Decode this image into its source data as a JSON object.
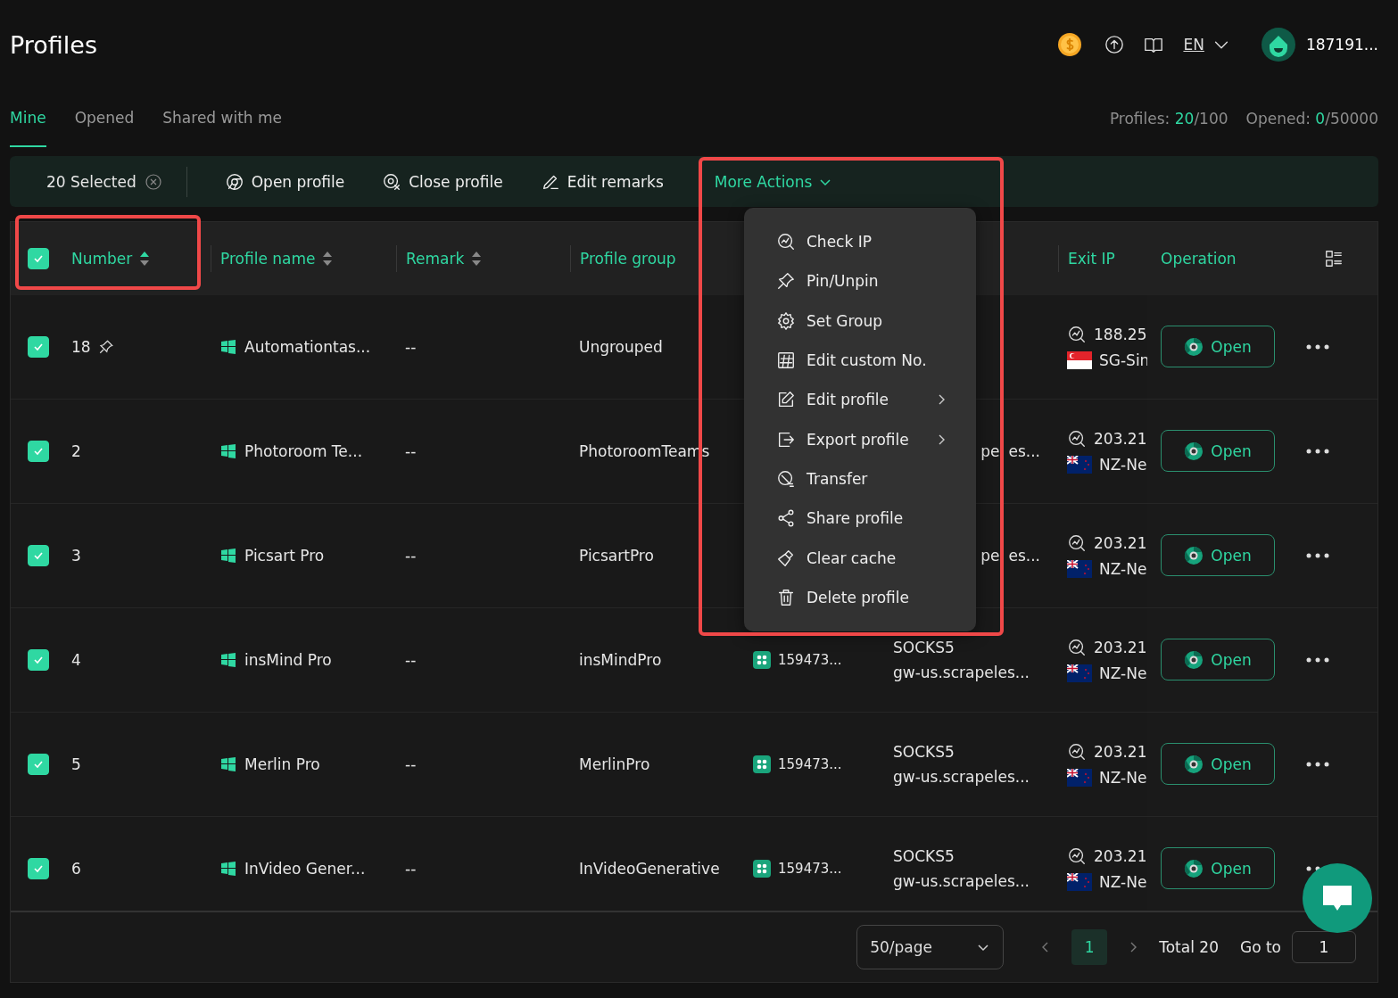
{
  "header": {
    "title": "Profiles",
    "language": "EN",
    "user": "187191..."
  },
  "tabs": [
    {
      "label": "Mine",
      "selected": true
    },
    {
      "label": "Opened",
      "selected": false
    },
    {
      "label": "Shared with me",
      "selected": false
    }
  ],
  "stats": [
    {
      "label": "Profiles:",
      "value": "20",
      "total": "/100"
    },
    {
      "label": "Opened:",
      "value": "0",
      "total": "/50000"
    }
  ],
  "toolbar": {
    "selected_count": "20 Selected",
    "actions": [
      {
        "kind": "open",
        "label": "Open profile"
      },
      {
        "kind": "close",
        "label": "Close profile"
      },
      {
        "kind": "edit",
        "label": "Edit remarks"
      }
    ],
    "more_actions": "More Actions"
  },
  "table": {
    "all_checked": true,
    "columns": [
      {
        "label": "Number",
        "sortable": true,
        "sorted_ascending": true
      },
      {
        "label": "Profile name",
        "sortable": true,
        "sorted_ascending": false
      },
      {
        "label": "Remark",
        "sortable": true,
        "sorted_ascending": false
      },
      {
        "label": "Profile group"
      },
      {
        "label": "Exit IP"
      },
      {
        "label": "Operation"
      }
    ],
    "rows": [
      {
        "checked": true,
        "number": "18",
        "pinned": true,
        "name": "Automationtas...",
        "remark": "--",
        "group": "Ungrouped",
        "ip": "188.25",
        "region": "SG-Sin",
        "flag": {
          "kind": "sg"
        },
        "action": "Open"
      },
      {
        "checked": true,
        "number": "2",
        "pinned": false,
        "name": "Photoroom Te...",
        "remark": "--",
        "group": "PhotoroomTeams",
        "proxy_fragments": [
          "pe",
          "es..."
        ],
        "ip": "203.21",
        "region": "NZ-Ne",
        "flag": {
          "kind": "nz"
        },
        "action": "Open"
      },
      {
        "checked": true,
        "number": "3",
        "pinned": false,
        "name": "Picsart Pro",
        "remark": "--",
        "group": "PicsartPro",
        "proxy_fragments": [
          "pe",
          "es..."
        ],
        "ip": "203.21",
        "region": "NZ-Ne",
        "flag": {
          "kind": "nz"
        },
        "action": "Open"
      },
      {
        "checked": true,
        "number": "4",
        "pinned": false,
        "name": "insMind Pro",
        "remark": "--",
        "group": "insMindPro",
        "tag": "159473...",
        "proxy_type": "SOCKS5",
        "proxy_host": "gw-us.scrapeles...",
        "ip": "203.21",
        "region": "NZ-Ne",
        "flag": {
          "kind": "nz"
        },
        "action": "Open"
      },
      {
        "checked": true,
        "number": "5",
        "pinned": false,
        "name": "Merlin Pro",
        "remark": "--",
        "group": "MerlinPro",
        "tag": "159473...",
        "proxy_type": "SOCKS5",
        "proxy_host": "gw-us.scrapeles...",
        "ip": "203.21",
        "region": "NZ-Ne",
        "flag": {
          "kind": "nz"
        },
        "action": "Open"
      },
      {
        "checked": true,
        "number": "6",
        "pinned": false,
        "name": "InVideo Gener...",
        "remark": "--",
        "group": "InVideoGenerative",
        "tag": "159473...",
        "proxy_type": "SOCKS5",
        "proxy_host": "gw-us.scrapeles...",
        "ip": "203.21",
        "region": "NZ-Ne",
        "flag": {
          "kind": "nz"
        },
        "action": "Open"
      }
    ]
  },
  "menu": [
    {
      "kind": "check_ip",
      "label": "Check IP",
      "submenu": false
    },
    {
      "kind": "pin",
      "label": "Pin/Unpin",
      "submenu": false
    },
    {
      "kind": "group",
      "label": "Set Group",
      "submenu": false
    },
    {
      "kind": "number",
      "label": "Edit custom No.",
      "submenu": false
    },
    {
      "kind": "edit",
      "label": "Edit profile",
      "submenu": true
    },
    {
      "kind": "export",
      "label": "Export profile",
      "submenu": true
    },
    {
      "kind": "transfer",
      "label": "Transfer",
      "submenu": false
    },
    {
      "kind": "share",
      "label": "Share profile",
      "submenu": false
    },
    {
      "kind": "clear",
      "label": "Clear cache",
      "submenu": false
    },
    {
      "kind": "delete",
      "label": "Delete profile",
      "submenu": false
    }
  ],
  "pagination": {
    "page_size": "50/page",
    "pages": [
      {
        "label": "1",
        "selected": true
      }
    ],
    "total": "Total 20",
    "goto_label": "Go to",
    "goto_value": "1"
  }
}
